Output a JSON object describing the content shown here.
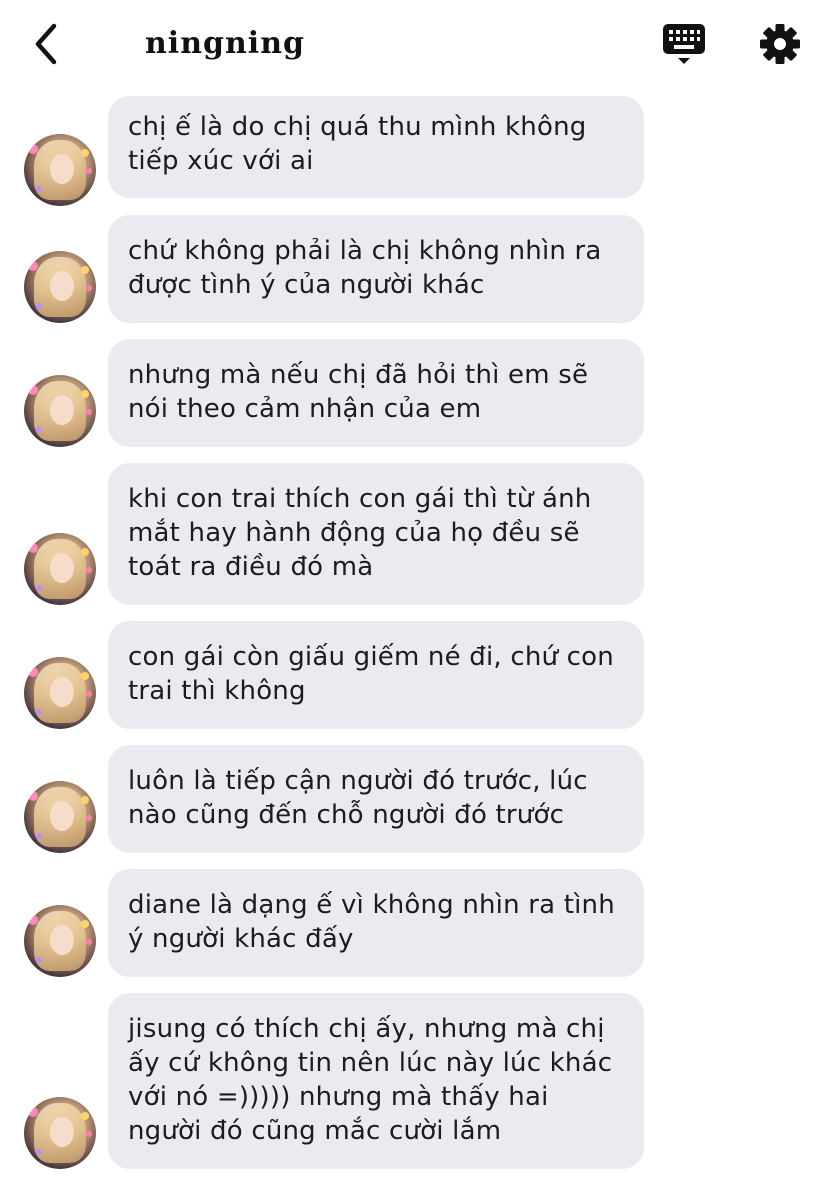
{
  "header": {
    "title": "ningning",
    "back_icon": "chevron-left-icon",
    "keyboard_icon": "keyboard-icon",
    "settings_icon": "gear-icon"
  },
  "messages": [
    {
      "text": "chị ế là do chị quá thu mình không tiếp xúc với ai"
    },
    {
      "text": "chứ không phải là chị không nhìn ra được tình ý của người khác"
    },
    {
      "text": "nhưng mà nếu chị đã hỏi thì em sẽ nói theo cảm nhận của em"
    },
    {
      "text": "khi con trai thích con gái thì từ ánh mắt hay hành động của họ đều sẽ toát ra điều đó mà"
    },
    {
      "text": "con gái còn giấu giếm né đi, chứ con trai thì không"
    },
    {
      "text": "luôn là tiếp cận người đó trước, lúc nào cũng đến chỗ người đó trước"
    },
    {
      "text": "diane là dạng ế vì không nhìn ra tình ý người khác đấy"
    },
    {
      "text": "jisung có thích chị ấy, nhưng mà chị ấy cứ không tin nên lúc này lúc khác với nó =))))) nhưng mà thấy hai người đó cũng mắc cười lắm"
    }
  ],
  "colors": {
    "bubble_bg": "#e9ebf0",
    "text": "#1c1c1e",
    "header_bg": "#ffffff"
  }
}
